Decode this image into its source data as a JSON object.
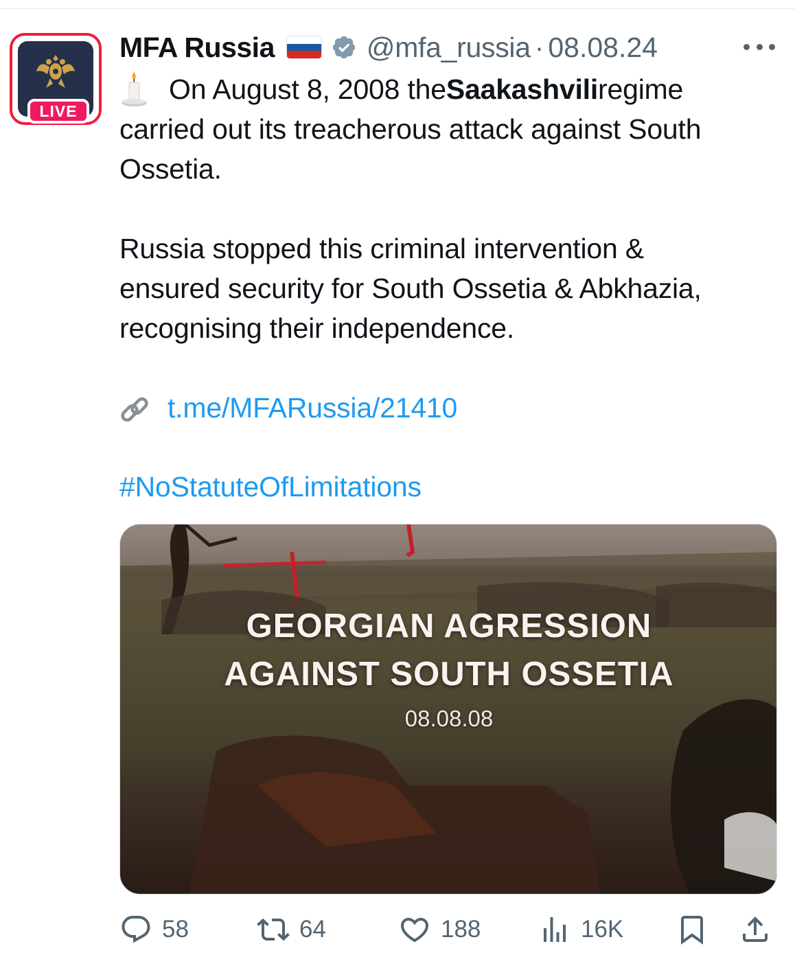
{
  "account": {
    "name": "MFA Russia",
    "flag": "russia-flag",
    "handle": "@mfa_russia",
    "separator": "·",
    "date": "08.08.24",
    "live_label": "LIVE",
    "verified_color": "#829aab"
  },
  "tweet": {
    "emoji": "candle",
    "line1_pre": "On August 8, 2008 the ",
    "line1_bold": "Saakashvili",
    "line1_post": " regime",
    "line2": "carried out its treacherous attack against South",
    "line3": "Ossetia.",
    "para2_line1": "Russia stopped this criminal intervention &",
    "para2_line2": "ensured security for South Ossetia & Abkhazia,",
    "para2_line3": "recognising their independence.",
    "link_icon": "chain-link-icon",
    "link": "t.me/MFARussia/21410",
    "hashtag": "#NoStatuteOfLimitations"
  },
  "media": {
    "title_line1": "GEORGIAN AGRESSION",
    "title_line2": "AGAINST SOUTH OSSETIA",
    "date": "08.08.08"
  },
  "actions": {
    "replies": "58",
    "reposts": "64",
    "likes": "188",
    "views": "16K"
  },
  "colors": {
    "text": "#0f1419",
    "secondary": "#536471",
    "link": "#1d9bf0",
    "live": "#f0195f",
    "live_border": "#f01d3a"
  }
}
